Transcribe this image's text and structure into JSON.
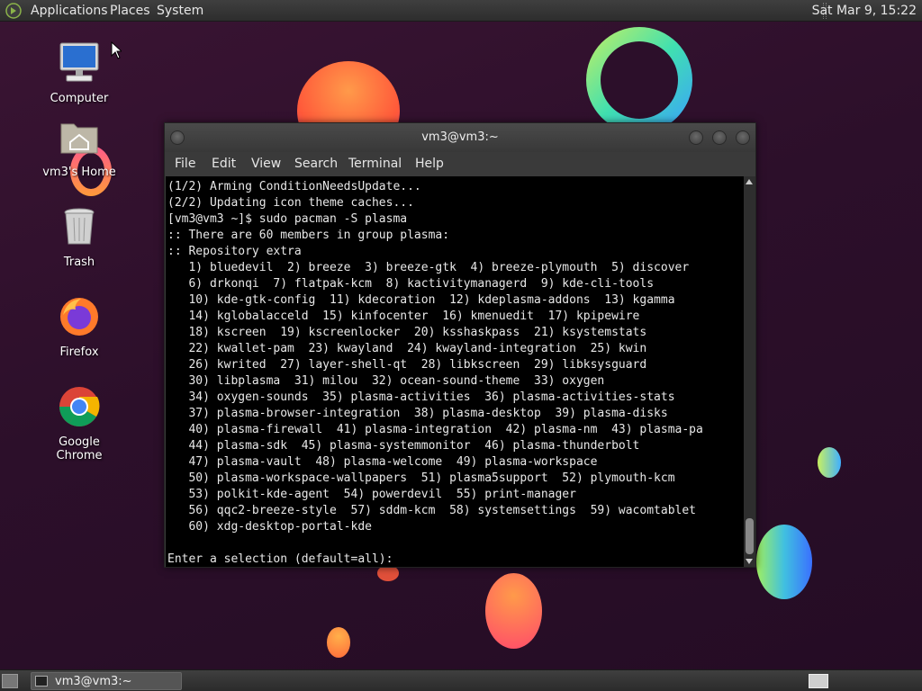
{
  "top_panel": {
    "menus": [
      "Applications",
      "Places",
      "System"
    ],
    "clock": "Sat Mar  9, 15:22"
  },
  "desktop_icons": [
    {
      "label": "Computer",
      "icon": "computer-icon"
    },
    {
      "label": "vm3's Home",
      "icon": "home-folder-icon"
    },
    {
      "label": "Trash",
      "icon": "trash-icon"
    },
    {
      "label": "Firefox",
      "icon": "firefox-icon"
    },
    {
      "label": "Google Chrome",
      "icon": "chrome-icon"
    }
  ],
  "terminal": {
    "title": "vm3@vm3:~",
    "menu": [
      "File",
      "Edit",
      "View",
      "Search",
      "Terminal",
      "Help"
    ],
    "lines": [
      "(1/2) Arming ConditionNeedsUpdate...",
      "(2/2) Updating icon theme caches...",
      "[vm3@vm3 ~]$ sudo pacman -S plasma",
      ":: There are 60 members in group plasma:",
      ":: Repository extra",
      "   1) bluedevil  2) breeze  3) breeze-gtk  4) breeze-plymouth  5) discover",
      "   6) drkonqi  7) flatpak-kcm  8) kactivitymanagerd  9) kde-cli-tools",
      "   10) kde-gtk-config  11) kdecoration  12) kdeplasma-addons  13) kgamma",
      "   14) kglobalacceld  15) kinfocenter  16) kmenuedit  17) kpipewire",
      "   18) kscreen  19) kscreenlocker  20) ksshaskpass  21) ksystemstats",
      "   22) kwallet-pam  23) kwayland  24) kwayland-integration  25) kwin",
      "   26) kwrited  27) layer-shell-qt  28) libkscreen  29) libksysguard",
      "   30) libplasma  31) milou  32) ocean-sound-theme  33) oxygen",
      "   34) oxygen-sounds  35) plasma-activities  36) plasma-activities-stats",
      "   37) plasma-browser-integration  38) plasma-desktop  39) plasma-disks",
      "   40) plasma-firewall  41) plasma-integration  42) plasma-nm  43) plasma-pa",
      "   44) plasma-sdk  45) plasma-systemmonitor  46) plasma-thunderbolt",
      "   47) plasma-vault  48) plasma-welcome  49) plasma-workspace",
      "   50) plasma-workspace-wallpapers  51) plasma5support  52) plymouth-kcm",
      "   53) polkit-kde-agent  54) powerdevil  55) print-manager",
      "   56) qqc2-breeze-style  57) sddm-kcm  58) systemsettings  59) wacomtablet",
      "   60) xdg-desktop-portal-kde",
      "",
      "Enter a selection (default=all):"
    ]
  },
  "taskbar": {
    "items": [
      {
        "label": "vm3@vm3:~"
      }
    ]
  }
}
